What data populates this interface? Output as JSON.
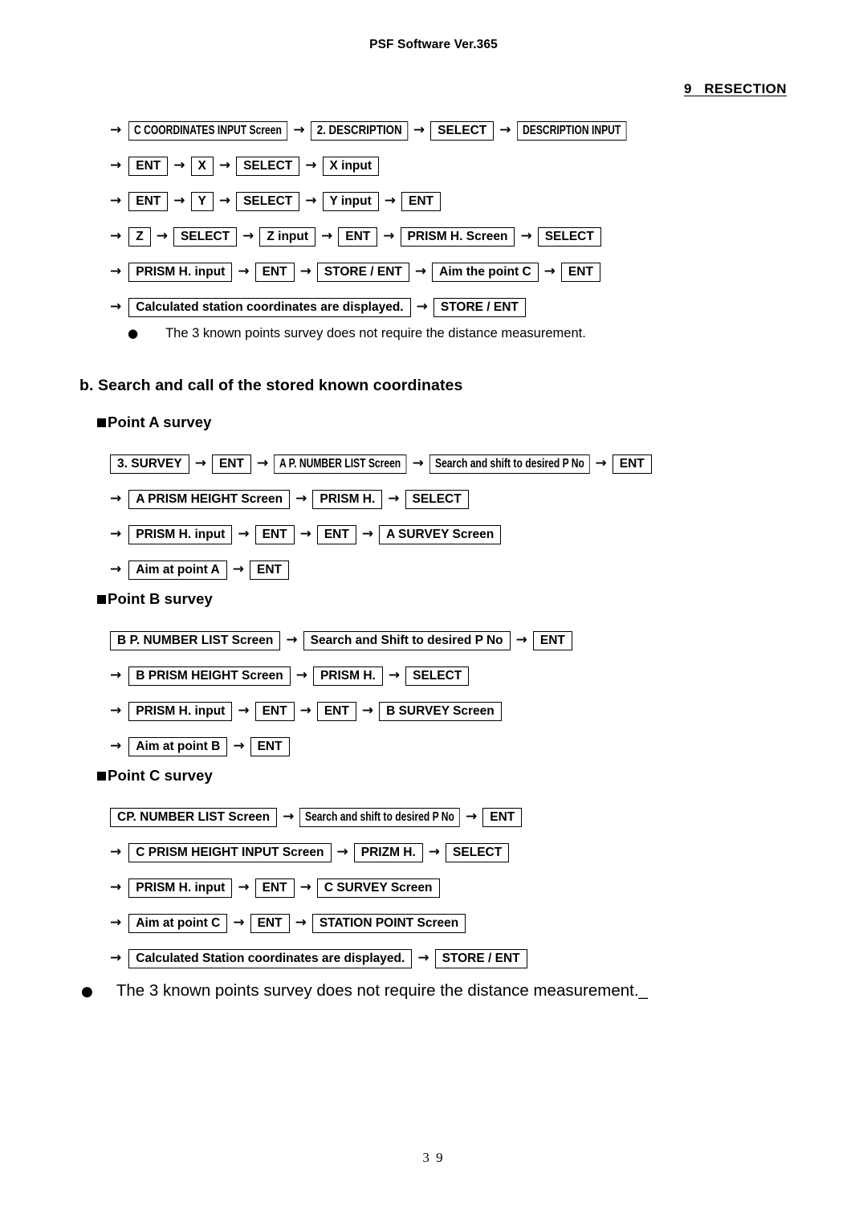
{
  "header": {
    "doc_title": "PSF Software Ver.365",
    "chapter": "9   RESECTION"
  },
  "flows": {
    "resection_input": [
      {
        "lead_arrow": "→",
        "steps": [
          "C COORDINATES INPUT Screen",
          "2. DESCRIPTION",
          "SELECT",
          "DESCRIPTION INPUT"
        ]
      },
      {
        "lead_arrow": "→",
        "steps": [
          "ENT",
          "X",
          "SELECT",
          "X input"
        ]
      },
      {
        "lead_arrow": "→",
        "steps": [
          "ENT",
          "Y",
          "SELECT",
          "Y input",
          "ENT"
        ]
      },
      {
        "lead_arrow": "→",
        "steps": [
          "Z",
          "SELECT",
          "Z input",
          "ENT",
          "PRISM H. Screen",
          "SELECT"
        ]
      },
      {
        "lead_arrow": "→",
        "steps": [
          "PRISM H. input",
          "ENT",
          "STORE / ENT",
          "Aim the point C",
          "ENT"
        ]
      },
      {
        "lead_arrow": "→",
        "steps": [
          "Calculated station coordinates are displayed.",
          "STORE / ENT"
        ]
      }
    ],
    "point_a": [
      {
        "lead_arrow": "",
        "steps": [
          "3. SURVEY",
          "ENT",
          "A P. NUMBER LIST Screen",
          "Search and shift to desired P No",
          "ENT"
        ]
      },
      {
        "lead_arrow": "→",
        "steps": [
          "A PRISM HEIGHT Screen",
          "PRISM H.",
          "SELECT"
        ]
      },
      {
        "lead_arrow": "→",
        "steps": [
          "PRISM H. input",
          "ENT",
          "ENT",
          "A SURVEY Screen"
        ]
      },
      {
        "lead_arrow": "→",
        "steps": [
          "Aim at point A",
          "ENT"
        ]
      }
    ],
    "point_b": [
      {
        "lead_arrow": "",
        "steps": [
          "B P. NUMBER LIST Screen",
          "Search and Shift to desired P No",
          "ENT"
        ]
      },
      {
        "lead_arrow": "→",
        "steps": [
          "B PRISM HEIGHT Screen",
          "PRISM H.",
          "SELECT"
        ]
      },
      {
        "lead_arrow": "→",
        "steps": [
          "PRISM H. input",
          "ENT",
          "ENT",
          "B SURVEY Screen"
        ]
      },
      {
        "lead_arrow": "→",
        "steps": [
          "Aim at point B",
          "ENT"
        ]
      }
    ],
    "point_c": [
      {
        "lead_arrow": "",
        "steps": [
          "CP. NUMBER LIST Screen",
          "Search and shift to desired P No",
          "ENT"
        ]
      },
      {
        "lead_arrow": "→",
        "steps": [
          "C PRISM HEIGHT INPUT Screen",
          "PRIZM H.",
          "SELECT"
        ]
      },
      {
        "lead_arrow": "→",
        "steps": [
          "PRISM H. input",
          "ENT",
          "C SURVEY Screen"
        ]
      },
      {
        "lead_arrow": "→",
        "steps": [
          "Aim at point C",
          "ENT",
          "STATION POINT Screen"
        ]
      },
      {
        "lead_arrow": "→",
        "steps": [
          "Calculated Station coordinates are displayed.",
          "STORE / ENT"
        ]
      }
    ]
  },
  "notes": {
    "note_top": "The 3 known points survey does not require the distance measurement.",
    "note_bottom": "The 3 known points survey does not require the distance measurement._"
  },
  "headings": {
    "section_b": "b. Search and call of the stored known coordinates",
    "point_a": "Point A survey",
    "point_b": "Point B survey",
    "point_c": "Point C survey"
  },
  "footer": {
    "page_number": "3 9"
  },
  "icons": {
    "arrow": "→",
    "bullet": "●",
    "square": "square-marker"
  }
}
